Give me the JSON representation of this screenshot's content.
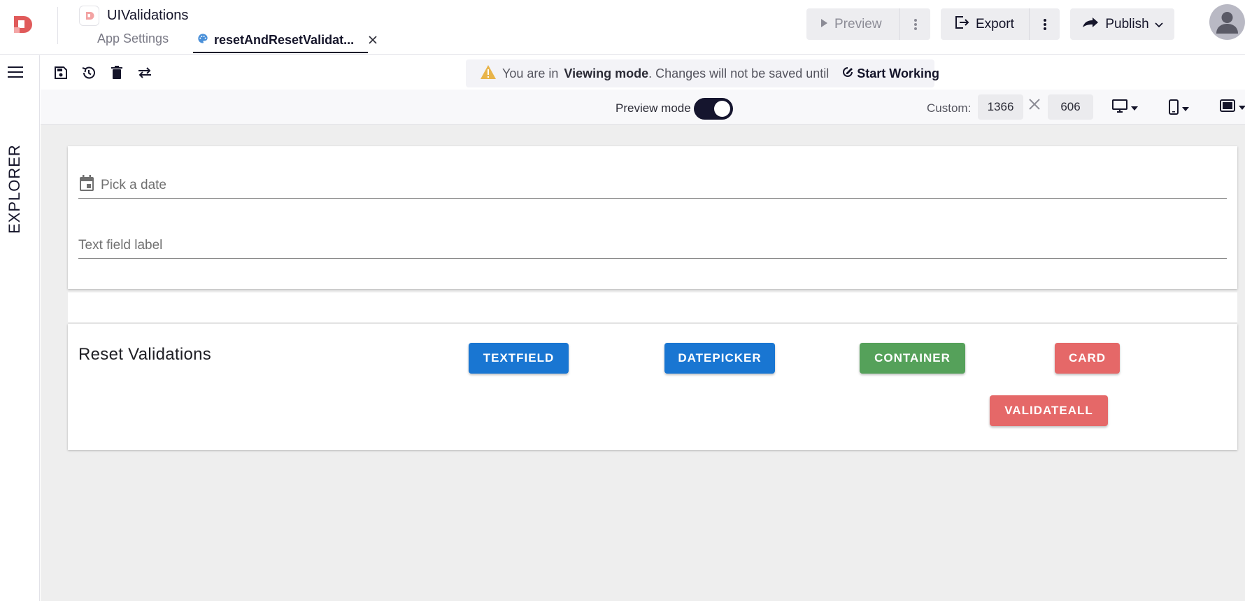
{
  "header": {
    "app_title": "UIValidations",
    "tabs": [
      {
        "label": "App Settings"
      },
      {
        "label": "resetAndResetValidat..."
      }
    ],
    "preview_label": "Preview",
    "export_label": "Export",
    "publish_label": "Publish"
  },
  "explorer": {
    "label": "EXPLORER"
  },
  "banner": {
    "prefix": "You are in",
    "mode": "Viewing mode",
    "suffix": ". Changes will not be saved until",
    "action": "Start Working"
  },
  "preview_bar": {
    "preview_mode_label": "Preview mode",
    "custom_label": "Custom:",
    "width": "1366",
    "height": "606"
  },
  "form": {
    "date_placeholder": "Pick a date",
    "text_field_label": "Text field label"
  },
  "reset_section": {
    "title": "Reset Validations",
    "buttons": {
      "textfield": "TEXTFIELD",
      "datepicker": "DATEPICKER",
      "container": "CONTAINER",
      "card": "CARD",
      "validateall": "VALIDATEALL"
    }
  },
  "colors": {
    "blue": "#1976d2",
    "green": "#55a15a",
    "red": "#e56868",
    "brand": "#e05a5a"
  },
  "icons": [
    "brand-logo-icon",
    "app-icon",
    "palette-icon",
    "close-icon",
    "play-icon",
    "more-vertical-icon",
    "export-icon",
    "publish-icon",
    "chevron-down-icon",
    "user-avatar-icon",
    "menu-icon",
    "save-icon",
    "history-icon",
    "delete-icon",
    "swap-icon",
    "warning-icon",
    "edit-circle-icon",
    "desktop-icon",
    "phone-icon",
    "tablet-icon",
    "calendar-icon"
  ]
}
